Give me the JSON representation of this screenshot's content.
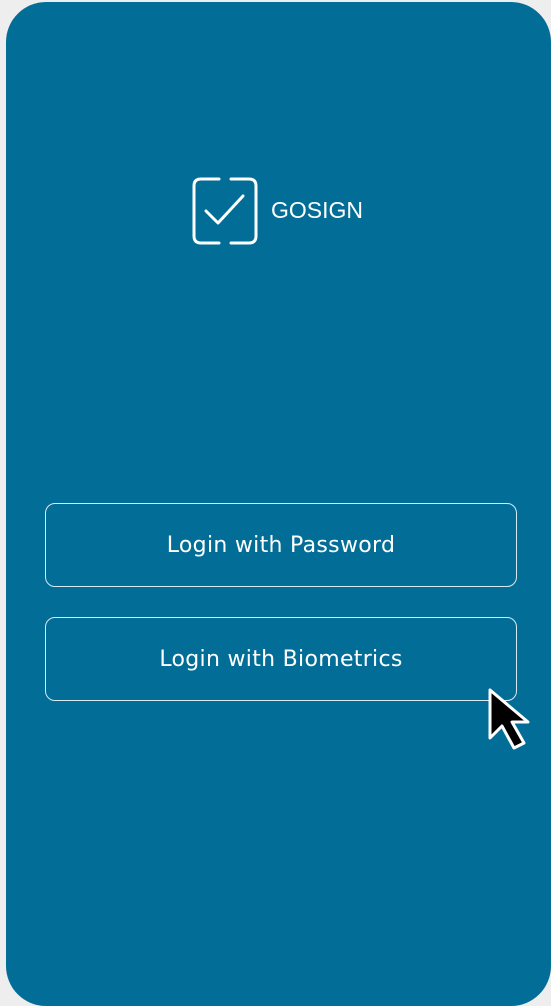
{
  "brand": {
    "name": "GOSIGN",
    "logo_icon": "checkbox-check-icon"
  },
  "buttons": {
    "password_label": "Login with Password",
    "biometrics_label": "Login with Biometrics"
  },
  "colors": {
    "background": "#026e97",
    "page_border": "#eeeeee",
    "text": "#ffffff",
    "button_border": "#ffffff"
  },
  "pointer": {
    "icon": "mouse-pointer-icon"
  }
}
